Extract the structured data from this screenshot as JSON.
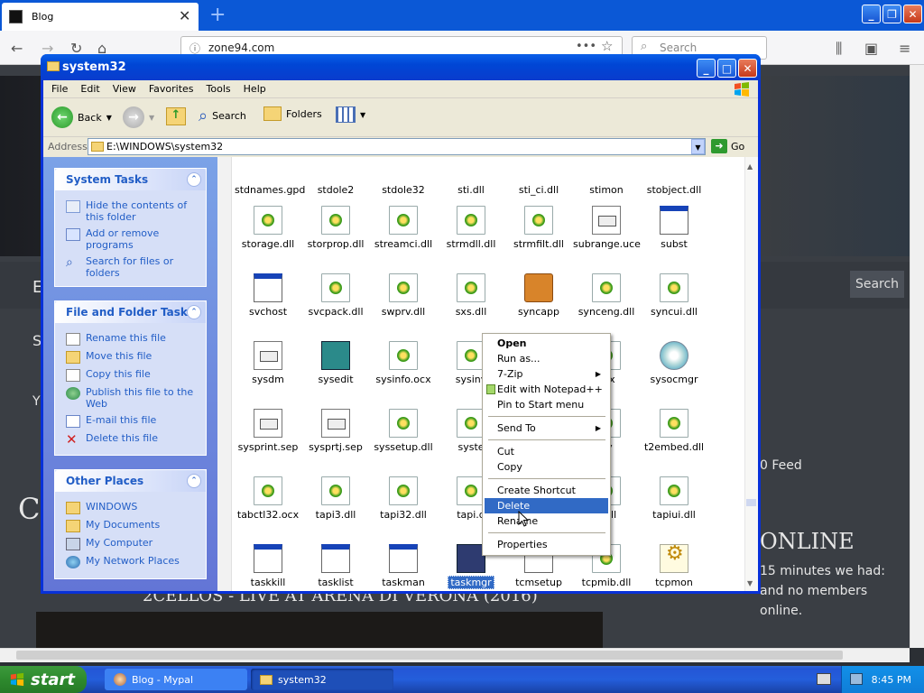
{
  "browser": {
    "tab_title": "Blog",
    "url": "zone94.com",
    "search_placeholder": "Search",
    "site_search_label": "Search",
    "site_texts": {
      "e": "E",
      "s": "S",
      "y": "Y",
      "ce": "CE",
      "video_title": "2CELLOS - LIVE AT ARENA DI VERONA (2016)",
      "feed": "0 Feed",
      "online": "ONLINE",
      "online_text": "15 minutes we had: and no members online."
    }
  },
  "explorer": {
    "title": "system32",
    "menu": [
      "File",
      "Edit",
      "View",
      "Favorites",
      "Tools",
      "Help"
    ],
    "toolbar": {
      "back": "Back",
      "search": "Search",
      "folders": "Folders"
    },
    "address_label": "Address",
    "address_value": "E:\\WINDOWS\\system32",
    "go": "Go",
    "system_tasks": {
      "title": "System Tasks",
      "items": [
        "Hide the contents of this folder",
        "Add or remove programs",
        "Search for files or folders"
      ]
    },
    "file_tasks": {
      "title": "File and Folder Tasks",
      "items": [
        "Rename this file",
        "Move this file",
        "Copy this file",
        "Publish this file to the Web",
        "E-mail this file",
        "Delete this file"
      ]
    },
    "other_places": {
      "title": "Other Places",
      "items": [
        "WINDOWS",
        "My Documents",
        "My Computer",
        "My Network Places"
      ]
    },
    "files": [
      [
        "stdnames.gpd",
        "stdole2",
        "stdole32",
        "sti.dll",
        "sti_ci.dll",
        "stimon",
        "stobject.dll"
      ],
      [
        "storage.dll",
        "storprop.dll",
        "streamci.dll",
        "strmdll.dll",
        "strmfilt.dll",
        "subrange.uce",
        "subst"
      ],
      [
        "svchost",
        "svcpack.dll",
        "swprv.dll",
        "sxs.dll",
        "syncapp",
        "synceng.dll",
        "syncui.dll"
      ],
      [
        "sysdm",
        "sysedit",
        "sysinfo.ocx",
        "sysinv",
        "",
        "ocx",
        "sysocmgr"
      ],
      [
        "sysprint.sep",
        "sysprtj.sep",
        "syssetup.dll",
        "syste",
        "",
        "ay",
        "t2embed.dll"
      ],
      [
        "tabctl32.ocx",
        "tapi3.dll",
        "tapi32.dll",
        "tapi.d",
        "",
        "v.dll",
        "tapiui.dll"
      ],
      [
        "taskkill",
        "tasklist",
        "taskman",
        "taskmgr",
        "tcmsetup",
        "tcpmib.dll",
        "tcpmon"
      ]
    ],
    "selected_file": "taskmgr"
  },
  "context_menu": {
    "open": "Open",
    "run_as": "Run as...",
    "zip": "7-Zip",
    "notepad": "Edit with Notepad++",
    "pin": "Pin to Start menu",
    "send_to": "Send To",
    "cut": "Cut",
    "copy": "Copy",
    "create_shortcut": "Create Shortcut",
    "delete": "Delete",
    "rename": "Rename",
    "properties": "Properties"
  },
  "taskbar": {
    "start": "start",
    "items": [
      "Blog - Mypal",
      "system32"
    ],
    "time": "8:45 PM"
  }
}
